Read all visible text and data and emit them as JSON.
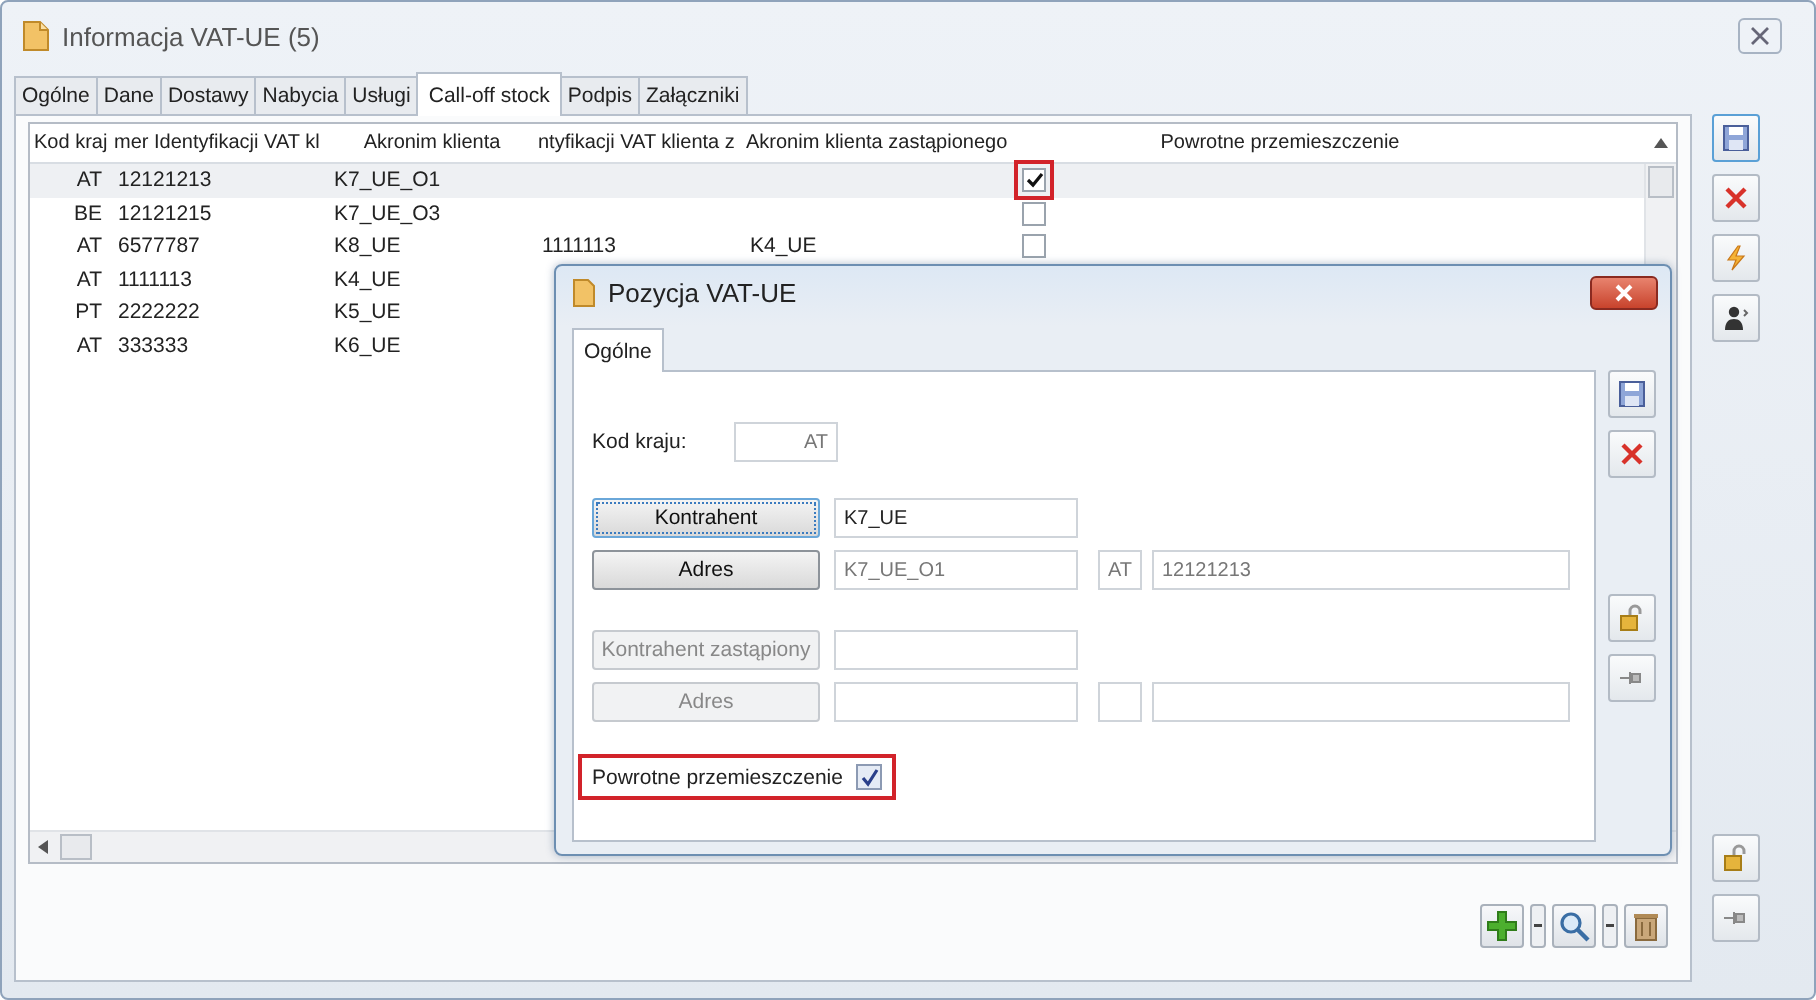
{
  "window": {
    "title": "Informacja VAT-UE (5)"
  },
  "tabs": [
    {
      "label": "Ogólne",
      "selected": false
    },
    {
      "label": "Dane",
      "selected": false
    },
    {
      "label": "Dostawy",
      "selected": false
    },
    {
      "label": "Nabycia",
      "selected": false
    },
    {
      "label": "Usługi",
      "selected": false
    },
    {
      "label": "Call-off stock",
      "selected": true
    },
    {
      "label": "Podpis",
      "selected": false
    },
    {
      "label": "Załączniki",
      "selected": false
    }
  ],
  "table": {
    "columns": [
      "Kod kraj",
      "mer Identyfikacji VAT kl",
      "Akronim klienta",
      "ntyfikacji VAT klienta z",
      "Akronim klienta zastąpionego",
      "Powrotne przemieszczenie"
    ],
    "rows": [
      {
        "cells": [
          "AT",
          "12121213",
          "K7_UE_O1"
        ],
        "selected": true,
        "returned": true,
        "highlighted": true
      },
      {
        "cells": [
          "BE",
          "12121215",
          "K7_UE_O3"
        ],
        "selected": false,
        "returned": false,
        "highlighted": false
      },
      {
        "cells": [
          "AT",
          "6577787",
          "K8_UE",
          "1111113",
          "K4_UE"
        ],
        "selected": false,
        "returned": false,
        "highlighted": false
      },
      {
        "cells": [
          "AT",
          "1111113",
          "K4_UE"
        ],
        "selected": false
      },
      {
        "cells": [
          "PT",
          "2222222",
          "K5_UE"
        ],
        "selected": false
      },
      {
        "cells": [
          "AT",
          "333333",
          "K6_UE"
        ],
        "selected": false
      }
    ]
  },
  "dialog": {
    "title": "Pozycja VAT-UE",
    "tabs": [
      {
        "label": "Ogólne",
        "selected": true
      }
    ],
    "country_label": "Kod kraju:",
    "country_value": "AT",
    "contractor": {
      "button": "Kontrahent",
      "disabled": false,
      "focused": true,
      "value": "K7_UE"
    },
    "address": {
      "button": "Adres",
      "disabled": false,
      "focused": false,
      "acronym": "K7_UE_O1",
      "country": "AT",
      "vat": "12121213"
    },
    "replaced_contractor": {
      "button": "Kontrahent zastąpiony",
      "disabled": true,
      "focused": false
    },
    "replaced_address": {
      "button": "Adres",
      "disabled": true,
      "focused": false
    },
    "return_movement": {
      "label": "Powrotne przemieszczenie",
      "checked": true,
      "highlighted": true
    }
  }
}
